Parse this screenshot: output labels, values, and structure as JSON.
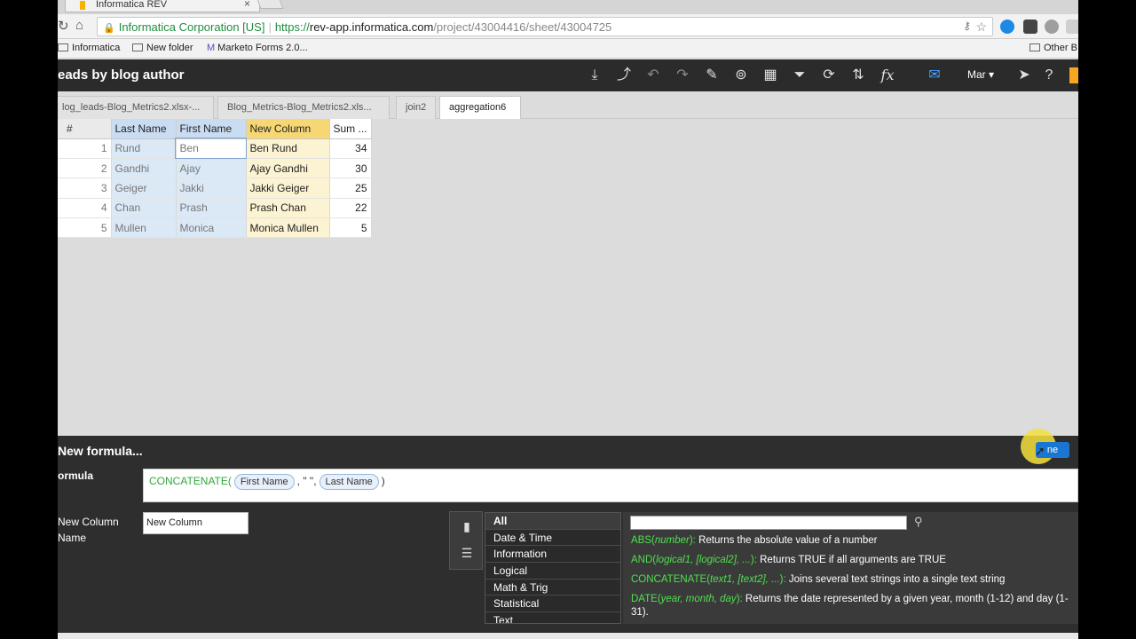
{
  "browser": {
    "tab_title": "Informatica REV",
    "org": "Informatica Corporation [US]",
    "url_scheme": "https://",
    "url_host": "rev-app.informatica.com",
    "url_path": "/project/43004416/sheet/43004725",
    "bookmarks": [
      "Informatica",
      "New folder",
      "Marketo Forms 2.0...",
      "Other B"
    ]
  },
  "header": {
    "title": "eads by blog author",
    "user": "Mar"
  },
  "sheet_tabs": [
    "log_leads-Blog_Metrics2.xlsx-...",
    "Blog_Metrics-Blog_Metrics2.xls...",
    "join2",
    "aggregation6"
  ],
  "grid": {
    "columns": [
      "#",
      "Last Name",
      "First Name",
      "New Column",
      "Sum ..."
    ],
    "rows": [
      [
        "1",
        "Rund",
        "Ben",
        "Ben Rund",
        "34"
      ],
      [
        "2",
        "Gandhi",
        "Ajay",
        "Ajay Gandhi",
        "30"
      ],
      [
        "3",
        "Geiger",
        "Jakki",
        "Jakki Geiger",
        "25"
      ],
      [
        "4",
        "Chan",
        "Prash",
        "Prash Chan",
        "22"
      ],
      [
        "5",
        "Mullen",
        "Monica",
        "Monica Mullen",
        "5"
      ]
    ]
  },
  "formula_panel": {
    "heading": "New formula...",
    "done_label": "ne",
    "formula_label": "ormula",
    "formula_fn": "CONCATENATE(",
    "formula_arg1": "First Name",
    "formula_sep": ", \" \",",
    "formula_arg2": "Last Name",
    "formula_end": ")",
    "newcol_label": "New Column Name",
    "newcol_value": "New Column",
    "categories": [
      "All",
      "Date & Time",
      "Information",
      "Logical",
      "Math & Trig",
      "Statistical",
      "Text"
    ],
    "functions": [
      {
        "name": "ABS(",
        "args": "number",
        "close": "):",
        "desc": " Returns the absolute value of a number"
      },
      {
        "name": "AND(",
        "args": "logical1, [logical2], ...",
        "close": "):",
        "desc": " Returns TRUE if all arguments are TRUE"
      },
      {
        "name": "CONCATENATE(",
        "args": "text1, [text2], ...",
        "close": "):",
        "desc": " Joins several text strings into a single text string"
      },
      {
        "name": "DATE(",
        "args": "year, month, day",
        "close": "):",
        "desc": " Returns the date represented by a given year, month (1-12) and day (1-31)."
      }
    ]
  }
}
